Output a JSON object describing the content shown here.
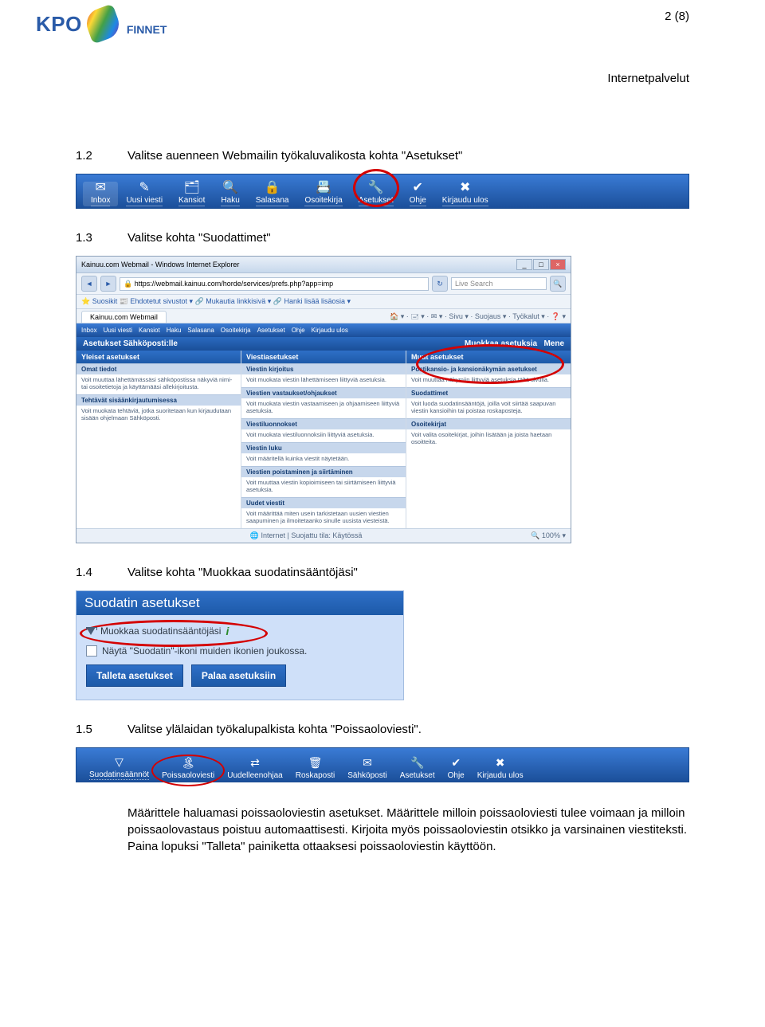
{
  "page_number": "2 (8)",
  "doc_header": "Internetpalvelut",
  "brand": {
    "kpo": "KPO",
    "finnet": "FINNET"
  },
  "steps": {
    "s1_2": {
      "num": "1.2",
      "text": "Valitse auenneen Webmailin työkaluvalikosta kohta \"Asetukset\""
    },
    "s1_3": {
      "num": "1.3",
      "text": "Valitse kohta \"Suodattimet\""
    },
    "s1_4": {
      "num": "1.4",
      "text": "Valitse kohta \"Muokkaa suodatinsääntöjäsi\""
    },
    "s1_5": {
      "num": "1.5",
      "text": "Valitse ylälaidan työkalupalkista kohta \"Poissaoloviesti\"."
    }
  },
  "final_para": "Määrittele haluamasi poissaoloviestin asetukset. Määrittele milloin poissaoloviesti tulee voimaan ja milloin poissaolovastaus poistuu automaattisesti. Kirjoita myös poissaoloviestin otsikko ja varsinainen viestiteksti. Paina lopuksi \"Talleta\" painiketta ottaaksesi poissaoloviestin käyttöön.",
  "toolbar1": {
    "items": [
      {
        "label": "Inbox",
        "icon": "✉"
      },
      {
        "label": "Uusi viesti",
        "icon": "✎"
      },
      {
        "label": "Kansiot",
        "icon": "🗂"
      },
      {
        "label": "Haku",
        "icon": "🔍"
      },
      {
        "label": "Salasana",
        "icon": "🔒"
      },
      {
        "label": "Osoitekirja",
        "icon": "📇"
      },
      {
        "label": "Asetukset",
        "icon": "🔧"
      },
      {
        "label": "Ohje",
        "icon": "✔"
      },
      {
        "label": "Kirjaudu ulos",
        "icon": "✖"
      }
    ]
  },
  "browser": {
    "title": "Kainuu.com Webmail - Windows Internet Explorer",
    "url": "https://webmail.kainuu.com/horde/services/prefs.php?app=imp",
    "search": "Live Search",
    "favbar": "⭐ Suosikit   📰 Ehdotetut sivustot ▾  🔗 Mukautia linkkisivä ▾  🔗 Hanki lisää lisäosia ▾",
    "tab": "Kainuu.com Webmail",
    "inner_toolbar": [
      "Inbox",
      "Uusi viesti",
      "Kansiot",
      "Haku",
      "Salasana",
      "Osoitekirja",
      "Asetukset",
      "Ohje",
      "Kirjaudu ulos"
    ],
    "subheader_left": "Asetukset Sähköposti:lle",
    "subheader_right_a": "Muokkaa asetuksia",
    "subheader_right_b": "Mene",
    "cols": {
      "a": {
        "head": "Yleiset asetukset",
        "rows": [
          {
            "sub": "Omat tiedot",
            "txt": "Voit muuttaa lähettämässäsi sähköpostissa näkyviä nimi- tai osoitetietoja ja käyttämääsi allekirjoitusta."
          },
          {
            "sub": "Tehtävät sisäänkirjautumisessa",
            "txt": "Voit muokata tehtäviä, jotka suoritetaan kun kirjaudutaan sisään ohjelmaan Sähköposti."
          }
        ]
      },
      "b": {
        "head": "Viestiasetukset",
        "rows": [
          {
            "sub": "Viestin kirjoitus",
            "txt": "Voit muokata viestin lähettämiseen liittyviä asetuksia."
          },
          {
            "sub": "Viestien vastaukset/ohjaukset",
            "txt": "Voit muokata viestin vastaamiseen ja ohjaamiseen liittyviä asetuksia."
          },
          {
            "sub": "Viestiluonnokset",
            "txt": "Voit muokata viestiluonnoksiin liittyviä asetuksia."
          },
          {
            "sub": "Viestin luku",
            "txt": "Voit määritellä kuinka viestit näytetään."
          },
          {
            "sub": "Viestien poistaminen ja siirtäminen",
            "txt": "Voit muuttaa viestin kopioimiseen tai siirtämiseen liittyviä asetuksia."
          },
          {
            "sub": "Uudet viestit",
            "txt": "Voit määrittää miten usein tarkistetaan uusien viestien saapuminen ja ilmoitetaanko sinulle uusista viesteistä."
          }
        ]
      },
      "c": {
        "head": "Muut asetukset",
        "rows": [
          {
            "sub": "Postikansio- ja kansionäkymän asetukset",
            "txt": "Voit muuttaa näkymiin liittyviä asetuksia tältä sivulla."
          },
          {
            "sub": "Suodattimet",
            "txt": "Voit luoda suodatinsääntöjä, joilla voit siirtää saapuvan viestin kansioihin tai poistaa roskaposteja."
          },
          {
            "sub": "Osoitekirjat",
            "txt": "Voit valita osoitekirjat, joihin lisätään ja joista haetaan osoitteita."
          }
        ]
      }
    },
    "status_left": "",
    "status_mid": "Internet | Suojattu tila: Käytössä",
    "status_right": "100%"
  },
  "panel": {
    "title": "Suodatin asetukset",
    "row1": "Muokkaa suodatinsääntöjäsi",
    "row2": "Näytä \"Suodatin\"-ikoni muiden ikonien joukossa.",
    "btn1": "Talleta asetukset",
    "btn2": "Palaa asetuksiin"
  },
  "toolbar2": {
    "items": [
      {
        "label": "Suodatinsäännöt",
        "icon": "▽"
      },
      {
        "label": "Poissaoloviesti",
        "icon": "🏝"
      },
      {
        "label": "Uudelleenohjaa",
        "icon": "⇄"
      },
      {
        "label": "Roskaposti",
        "icon": "🗑"
      },
      {
        "label": "Sähköposti",
        "icon": "✉"
      },
      {
        "label": "Asetukset",
        "icon": "🔧"
      },
      {
        "label": "Ohje",
        "icon": "✔"
      },
      {
        "label": "Kirjaudu ulos",
        "icon": "✖"
      }
    ]
  }
}
